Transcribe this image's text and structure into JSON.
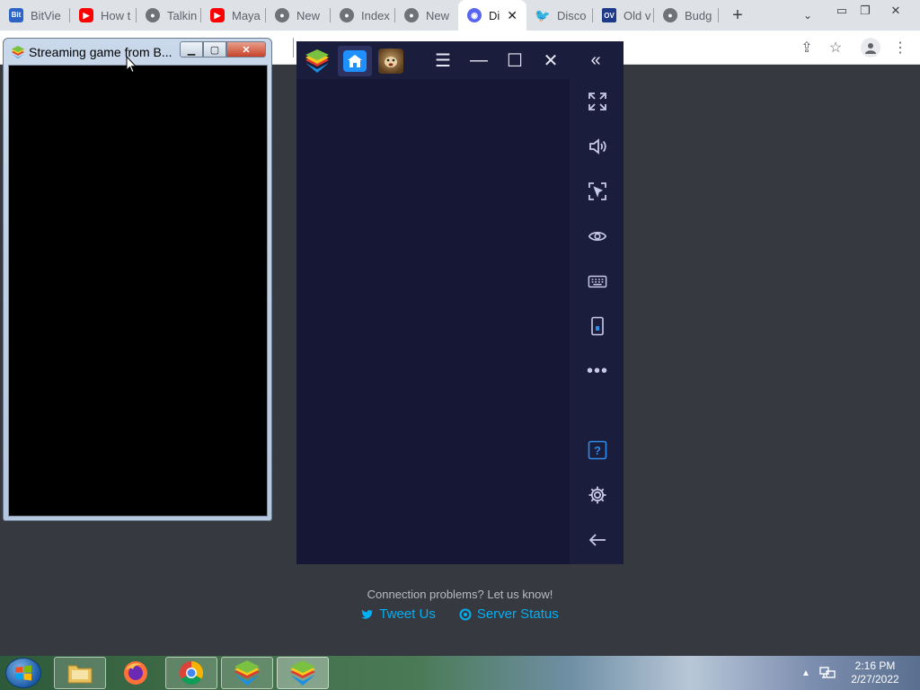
{
  "browser": {
    "tabs": [
      {
        "icon": "bitview-icon",
        "title": "BitVie"
      },
      {
        "icon": "youtube-icon",
        "title": "How t"
      },
      {
        "icon": "globe-icon",
        "title": "Talkin"
      },
      {
        "icon": "youtube-icon",
        "title": "Maya"
      },
      {
        "icon": "globe-icon",
        "title": "New"
      },
      {
        "icon": "globe-icon",
        "title": "Index"
      },
      {
        "icon": "globe-icon",
        "title": "New"
      },
      {
        "icon": "discord-icon",
        "title": "Di",
        "active": true
      },
      {
        "icon": "twitter-icon",
        "title": "Disco"
      },
      {
        "icon": "ov-icon",
        "title": "Old v"
      },
      {
        "icon": "globe-icon",
        "title": "Budg"
      }
    ],
    "bitview_badge": "Bit",
    "ov_badge": "OV"
  },
  "streaming_window": {
    "title": "Streaming game from B..."
  },
  "discord": {
    "connection_text": "Connection problems? Let us know!",
    "tweet_label": "Tweet Us",
    "status_label": "Server Status",
    "link_color": "#00b0f4"
  },
  "taskbar": {
    "time": "2:16 PM",
    "date": "2/27/2022"
  }
}
